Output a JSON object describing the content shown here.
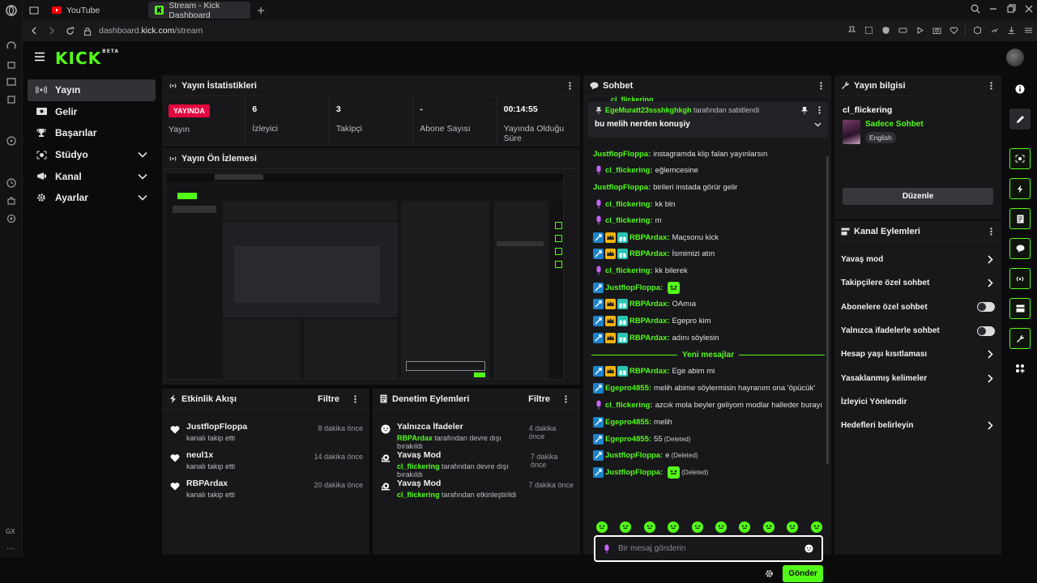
{
  "browser": {
    "tabs": [
      {
        "label": "YouTube"
      },
      {
        "label": "Stream - Kick Dashboard"
      }
    ],
    "url_prefix": "dashboard.",
    "url_domain": "kick.com",
    "url_path": "/stream",
    "gx_label": "GX"
  },
  "header": {
    "logo": "KICK",
    "logo_badge": "BETA"
  },
  "sidebar": {
    "items": [
      {
        "label": "Yayın",
        "icon": "broadcast-icon"
      },
      {
        "label": "Gelir",
        "icon": "money-icon"
      },
      {
        "label": "Başarılar",
        "icon": "trophy-icon"
      },
      {
        "label": "Stüdyo",
        "icon": "studio-icon"
      },
      {
        "label": "Kanal",
        "icon": "channel-icon"
      },
      {
        "label": "Ayarlar",
        "icon": "gear-icon"
      }
    ]
  },
  "stats": {
    "title": "Yayın İstatistikleri",
    "live_badge": "YAYINDA",
    "items": [
      {
        "value": "",
        "label": "Yayın"
      },
      {
        "value": "6",
        "label": "İzleyici"
      },
      {
        "value": "3",
        "label": "Takipçi"
      },
      {
        "value": "-",
        "label": "Abone Sayısı"
      },
      {
        "value": "00:14:55",
        "label": "Yayında Olduğu Süre"
      }
    ]
  },
  "preview": {
    "title": "Yayın Ön İzlemesi"
  },
  "activity": {
    "title": "Etkinlik Akışı",
    "filter": "Filtre",
    "items": [
      {
        "user": "JustflopFloppa",
        "action": "kanalı takip etti",
        "time": "8 dakika önce"
      },
      {
        "user": "neul1x",
        "action": "kanalı takip etti",
        "time": "14 dakika önce"
      },
      {
        "user": "RBPArdax",
        "action": "kanalı takip etti",
        "time": "20 dakika önce"
      }
    ]
  },
  "moderation": {
    "title": "Denetim Eylemleri",
    "filter": "Filtre",
    "items": [
      {
        "action": "Yalnızca İfadeler",
        "user": "RBPArdax",
        "detail": "tarafından devre dışı bırakıldı",
        "time": "4 dakika önce"
      },
      {
        "action": "Yavaş Mod",
        "user": "cl_flickering",
        "detail": "tarafından devre dışı bırakıldı",
        "time": "7 dakika önce"
      },
      {
        "action": "Yavaş Mod",
        "user": "cl_flickering",
        "detail": "tarafından etkinleştirildi",
        "time": "7 dakika önce"
      }
    ]
  },
  "chat": {
    "title": "Sohbet",
    "pinned_user": "EgeMuratt23ssshkghkgh",
    "pinned_by": "tarafından sabitlendi",
    "pinned_text": "bu melih nerden konuşiy",
    "messages": [
      {
        "user": "JustflopFloppa",
        "text": "instagramda klip falan yayınlarsın",
        "badges": []
      },
      {
        "user": "cl_flickering",
        "text": "eğlemcesine",
        "badges": [
          "mic"
        ]
      },
      {
        "user": "JustflopFloppa",
        "text": "birileri instada görür gelir",
        "badges": []
      },
      {
        "user": "cl_flickering",
        "text": "kk bln",
        "badges": [
          "mic"
        ]
      },
      {
        "user": "cl_flickering",
        "text": "m",
        "badges": [
          "mic"
        ]
      },
      {
        "user": "RBPArdax",
        "text": "Maçsonu kick",
        "badges": [
          "sword",
          "crown",
          "gift"
        ]
      },
      {
        "user": "RBPArdax",
        "text": "İsmimizi atın",
        "badges": [
          "sword",
          "crown",
          "gift"
        ]
      },
      {
        "user": "cl_flickering",
        "text": "kk bilerek",
        "badges": [
          "mic"
        ]
      },
      {
        "user": "JustflopFloppa",
        "text": "",
        "badges": [
          "sword"
        ],
        "emote": true
      },
      {
        "user": "RBPArdax",
        "text": "OAmıa",
        "badges": [
          "sword",
          "crown",
          "gift"
        ]
      },
      {
        "user": "RBPArdax",
        "text": "Egepro kim",
        "badges": [
          "sword",
          "crown",
          "gift"
        ]
      },
      {
        "user": "RBPArdax",
        "text": "adını söylesin",
        "badges": [
          "sword",
          "crown",
          "gift"
        ]
      },
      {
        "user": "RBPArdax",
        "text": "Ege abim mi",
        "badges": [
          "sword",
          "crown",
          "gift"
        ]
      },
      {
        "user": "Egepro4855",
        "text": "melih abime söylermisin hayranım ona 'öpücük'",
        "badges": [
          "sword"
        ]
      },
      {
        "user": "cl_flickering",
        "text": "azcık mola beyler geliyom modlar halleder burayı",
        "badges": [
          "mic"
        ]
      },
      {
        "user": "Egepro4855",
        "text": "melih",
        "badges": [
          "sword"
        ]
      },
      {
        "user": "Egepro4855",
        "text": "55",
        "badges": [
          "sword"
        ],
        "deleted": "(Deleted)"
      },
      {
        "user": "JustflopFloppa",
        "text": "e",
        "badges": [
          "sword"
        ],
        "deleted": "(Deleted)"
      },
      {
        "user": "JustflopFloppa",
        "text": "",
        "badges": [
          "sword"
        ],
        "emote": true,
        "deleted": "(Deleted)"
      }
    ],
    "new_messages": "Yeni mesajlar",
    "input_placeholder": "Bir mesaj gönderin",
    "send_label": "Gönder",
    "scrolled_hint": "cl_flickering"
  },
  "info": {
    "title": "Yayın bilgisi",
    "channel": "cl_flickering",
    "category": "Sadece Sohbet",
    "language": "English",
    "edit_label": "Düzenle"
  },
  "channel_actions": {
    "title": "Kanal Eylemleri",
    "items": [
      {
        "label": "Yavaş mod",
        "kind": "chevron"
      },
      {
        "label": "Takipçilere özel sohbet",
        "kind": "chevron"
      },
      {
        "label": "Abonelere özel sohbet",
        "kind": "toggle"
      },
      {
        "label": "Yalnızca ifadelerle sohbet",
        "kind": "toggle"
      },
      {
        "label": "Hesap yaşı kısıtlaması",
        "kind": "chevron"
      },
      {
        "label": "Yasaklanmış kelimeler",
        "kind": "chevron"
      },
      {
        "label": "İzleyici Yönlendir",
        "kind": "none"
      },
      {
        "label": "Hedefleri belirleyin",
        "kind": "chevron"
      }
    ]
  },
  "colors": {
    "accent": "#53fc18",
    "live": "#e4063e",
    "username_blue": "#53fc18"
  }
}
